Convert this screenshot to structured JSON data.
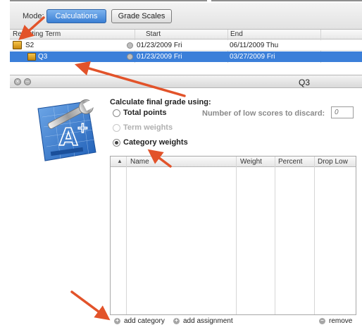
{
  "toolbar": {
    "mode_label": "Mode:",
    "segments": [
      {
        "label": "Calculations",
        "selected": true
      },
      {
        "label": "Grade Scales",
        "selected": false
      }
    ]
  },
  "terms_table": {
    "columns": [
      "Reporting Term",
      "Start",
      "End"
    ],
    "rows": [
      {
        "name": "S2",
        "start": "01/23/2009 Fri",
        "end": "06/11/2009 Thu",
        "selected": false
      },
      {
        "name": "Q3",
        "start": "01/23/2009 Fri",
        "end": "03/27/2009 Fri",
        "selected": true
      }
    ]
  },
  "panel": {
    "title": "Q3"
  },
  "calculation": {
    "heading": "Calculate final grade using:",
    "options": [
      {
        "label": "Total points",
        "selected": false,
        "enabled": true
      },
      {
        "label": "Term weights",
        "selected": false,
        "enabled": false
      },
      {
        "label": "Category weights",
        "selected": true,
        "enabled": true
      }
    ],
    "low_scores_label": "Number of low scores to discard:",
    "low_scores_placeholder": "0"
  },
  "category_table": {
    "columns": [
      "Name",
      "Weight",
      "Percent",
      "Drop Low"
    ],
    "rows": []
  },
  "bottom_actions": {
    "add_category": "add category",
    "add_assignment": "add assignment",
    "remove": "remove"
  },
  "colors": {
    "accent": "#3b7fd9",
    "annotation_arrow": "#e2532a"
  },
  "icons": {
    "app": "grade-calculator-a-plus-icon",
    "folder": "folder-icon",
    "close": "close-icon",
    "minimize": "minimize-icon"
  }
}
